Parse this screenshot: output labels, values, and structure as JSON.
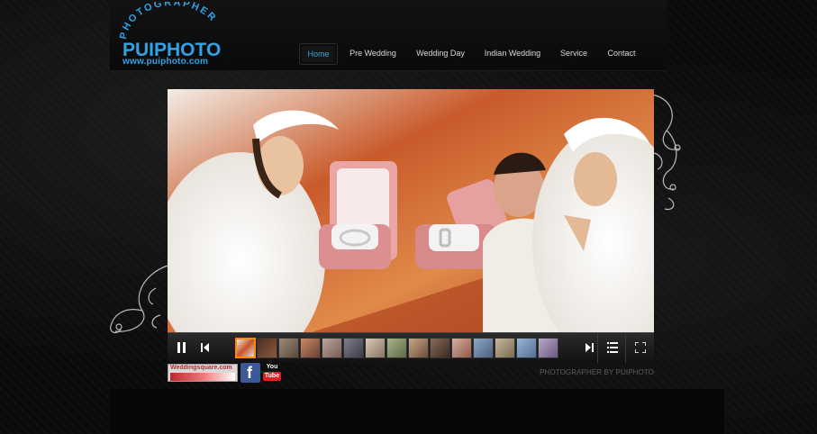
{
  "logo": {
    "arc_text": "PHOTOGRAPHER",
    "brand": "PUIPHOTO",
    "url": "www.puiphoto.com"
  },
  "nav": {
    "items": [
      {
        "label": "Home",
        "active": true
      },
      {
        "label": "Pre Wedding",
        "active": false
      },
      {
        "label": "Wedding Day",
        "active": false
      },
      {
        "label": "Indian Wedding",
        "active": false
      },
      {
        "label": "Service",
        "active": false
      },
      {
        "label": "Contact",
        "active": false
      }
    ]
  },
  "slideshow": {
    "controls": {
      "pause_icon": "pause-icon",
      "prev_icon": "previous-icon",
      "next_icon": "next-icon",
      "list_icon": "list-icon",
      "fullscreen_icon": "fullscreen-icon"
    },
    "thumbnail_count": 15,
    "selected_thumbnail": 1
  },
  "footer": {
    "badge_text": "Weddingsquare.com",
    "facebook_label": "f",
    "youtube_you": "You",
    "youtube_tube": "Tube",
    "credit": "PHOTOGRAPHER BY PUIPHOTO"
  },
  "colors": {
    "accent_blue": "#2fa3e6",
    "active_nav": "#3aa6e0",
    "background": "#0b0b0b"
  }
}
